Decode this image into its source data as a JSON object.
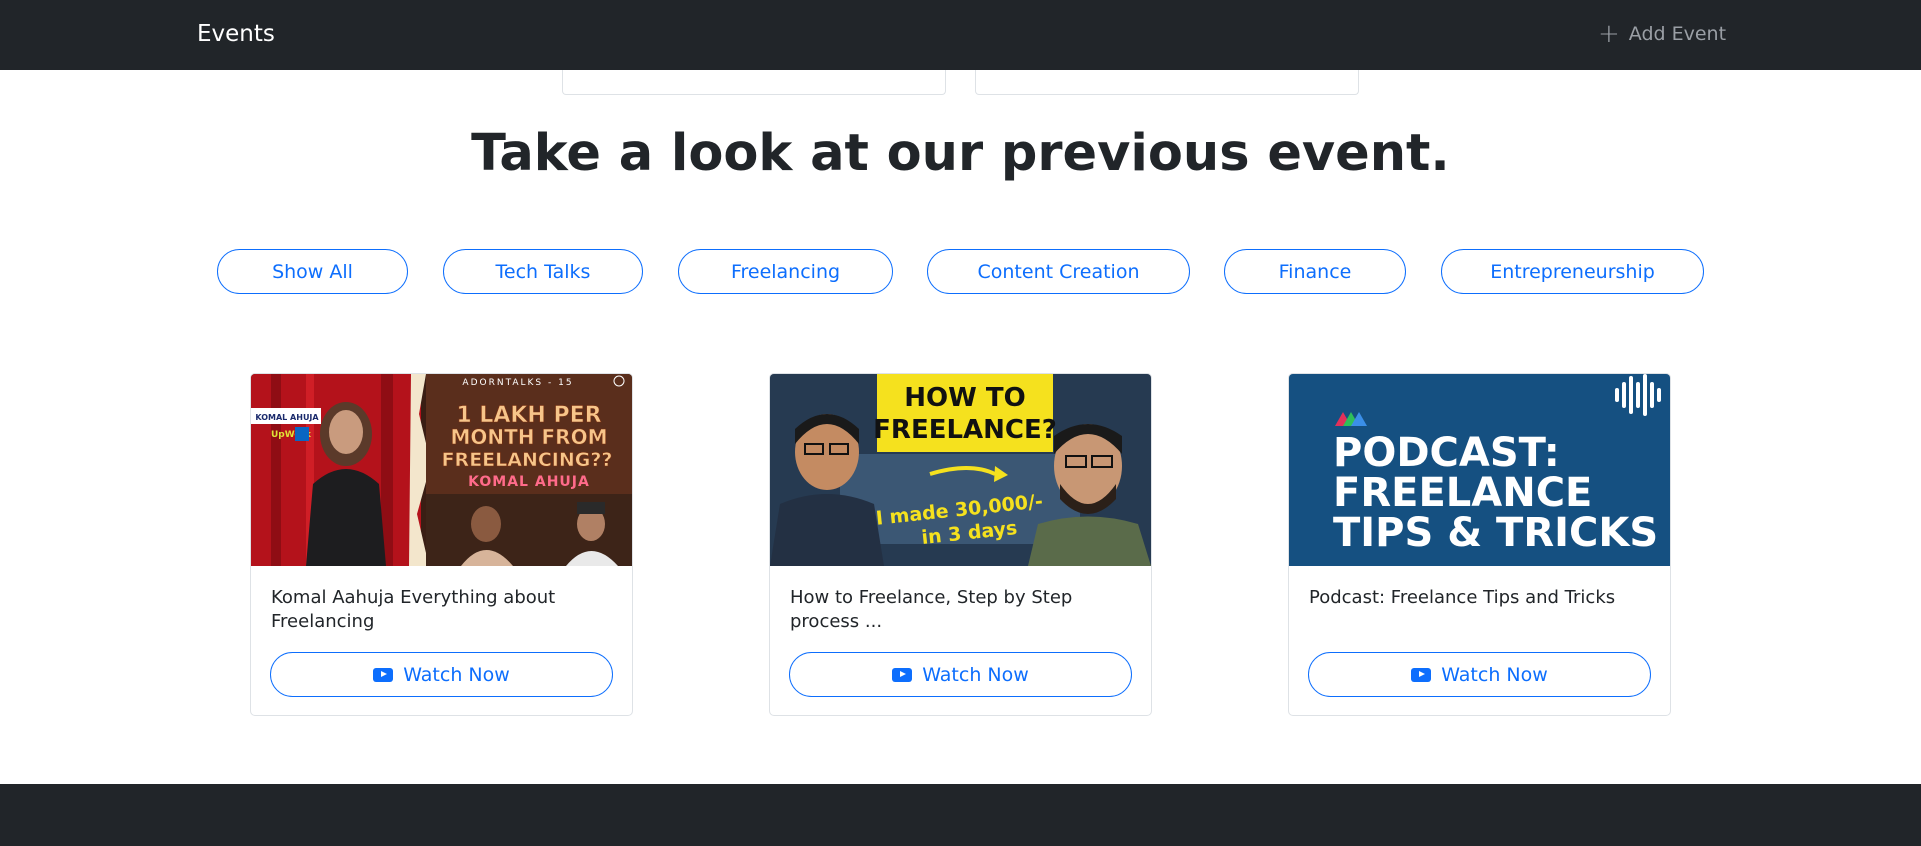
{
  "nav": {
    "brand": "Events",
    "add_event": "Add Event"
  },
  "section": {
    "heading": "Take a look at our previous event."
  },
  "filters": [
    "Show All",
    "Tech Talks",
    "Freelancing",
    "Content Creation",
    "Finance",
    "Entrepreneurship"
  ],
  "cards": [
    {
      "title": "Komal Aahuja Everything about Freelancing",
      "button": "Watch Now",
      "thumb": {
        "series": "ADORNTALKS - 15",
        "headline1": "1 LAKH PER",
        "headline2": "MONTH FROM",
        "headline3": "FREELANCING??",
        "name": "KOMAL AHUJA",
        "badge1": "KOMAL AHUJA",
        "badge2": "UpWork"
      }
    },
    {
      "title": "How to Freelance, Step by Step process ...",
      "button": "Watch Now",
      "thumb": {
        "banner1": "HOW TO",
        "banner2": "FREELANCE?",
        "claim1": "I made 30,000/-",
        "claim2": "in 3 days"
      }
    },
    {
      "title": "Podcast: Freelance Tips and Tricks",
      "button": "Watch Now",
      "thumb": {
        "line1": "PODCAST:",
        "line2": "FREELANCE",
        "line3": "TIPS & TRICKS"
      }
    }
  ],
  "colors": {
    "accent": "#0d6efd",
    "dark": "#212529"
  }
}
